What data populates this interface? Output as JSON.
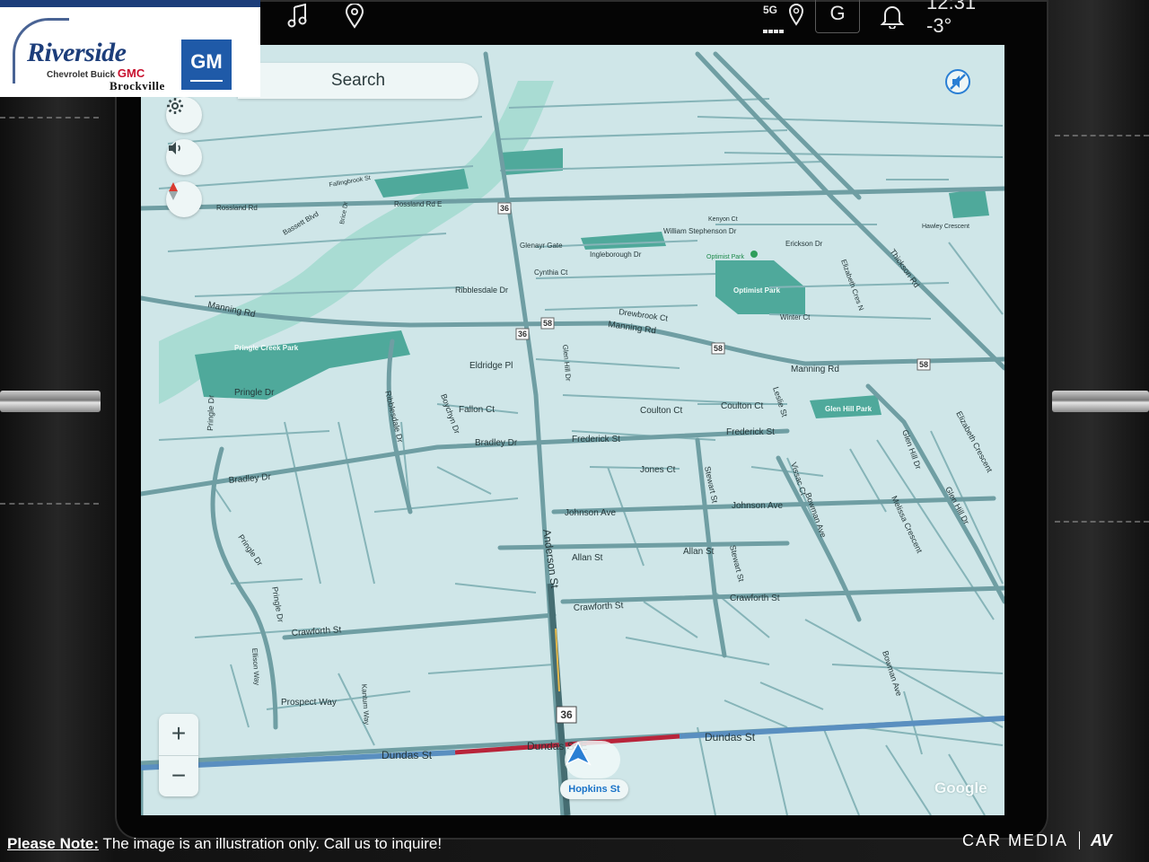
{
  "dealer": {
    "name": "Riverside",
    "brands": [
      "Chevrolet",
      "Buick",
      "GMC"
    ],
    "city": "Brockville",
    "badge": "GM"
  },
  "status_bar": {
    "music_icon": "music-note-icon",
    "location_icon": "location-pin-icon",
    "network": "5G",
    "profile_initial": "G",
    "notifications_icon": "bell-icon",
    "time": "12:31",
    "temperature": "-3°"
  },
  "map": {
    "search_placeholder": "Search",
    "current_location_label": "Hopkins St",
    "watermark": "Google",
    "zoom_in_label": "+",
    "zoom_out_label": "−",
    "colors": {
      "land": "#cfe6e8",
      "park": "#4fa99b",
      "river": "#a9dcd3",
      "road": "#6f9ea3",
      "traffic_red": "#b8243a",
      "route_blue": "#5a8fc0",
      "nav_arrow": "#2a7fd4"
    },
    "roads": {
      "anderson": "Anderson St",
      "manning_left": "Manning Rd",
      "manning_mid": "Manning Rd",
      "manning_right": "Manning Rd",
      "dundas_left": "Dundas St",
      "dundas_mid": "Dundas St E",
      "dundas_right": "Dundas St",
      "rossland": "Rossland Rd",
      "rossland_mid": "Rossland Rd E",
      "thickson": "Thickson Rd",
      "ribblesdale": "Ribblesdale Dr",
      "ribblesdale_top": "Ribblesdale Dr",
      "frederick": "Frederick St",
      "frederick_right": "Frederick St",
      "bradley_left": "Bradley Dr",
      "bradley_mid": "Bradley Dr",
      "johnson": "Johnson Ave",
      "johnson_right": "Johnson Ave",
      "allan": "Allan St",
      "allan_right": "Allan St",
      "crawforth_left": "Crawforth St",
      "crawforth_mid": "Crawforth St",
      "crawforth_right": "Crawforth St",
      "coulton_mid": "Coulton Ct",
      "coulton_right": "Coulton Ct",
      "jones": "Jones Ct",
      "stewart_top": "Stewart St",
      "stewart_bottom": "Stewart St",
      "glen_hill": "Glen Hill Dr",
      "glen_hill_right": "Glen Hill Dr",
      "glen_hill_far": "Glen Hill Dr",
      "melissa": "Melissa Crescent",
      "elizabeth": "Elizabeth Crescent",
      "elizabeth_n": "Elizabeth Cres N",
      "bowman_top": "Bowman Ave",
      "bowman_bottom": "Bowman Ave",
      "vissac": "Vissac Ct",
      "leslie": "Leslie St",
      "pringle_left": "Pringle Dr",
      "pringle_mid": "Pringle Dr",
      "pringle_lower": "Pringle Dr",
      "pringle_bottom": "Pringle Dr",
      "prospect": "Prospect Way",
      "boychyn": "Boychyn Dr",
      "fallon": "Fallon Ct",
      "eldridge": "Eldridge Pl",
      "drewbrook": "Drewbrook Ct",
      "cynthia": "Cynthia Ct",
      "ingleborough": "Ingleborough Dr",
      "glenayr": "Glenayr Gate",
      "william_stephenson": "William Stephenson Dr",
      "erickson": "Erickson Dr",
      "winter": "Winter Ct",
      "bassett": "Bassett Blvd",
      "fallingbrook": "Fallingbrook St",
      "kenyon": "Kenyon Ct",
      "hawley": "Hawley Crescent",
      "hopkins": "Hopkins St",
      "kantum": "Kantum Way",
      "ellison": "Ellison Way",
      "brice": "Brice Dr"
    },
    "parks": {
      "pringle_creek": "Pringle Creek Park",
      "optimist": "Optimist Park",
      "glen_hill": "Glen Hill Park",
      "optimist_poi": "Optimist Park"
    },
    "shields": {
      "route_58_a": "58",
      "route_58_b": "58",
      "route_58_c": "58",
      "route_36_a": "36",
      "route_36_b": "36",
      "route_36_c": "36"
    }
  },
  "footer": {
    "note_label": "Please Note:",
    "note_text": " The image is an illustration only. Call us to inquire!",
    "brand": "CAR MEDIA",
    "brand_mark": "AV"
  }
}
